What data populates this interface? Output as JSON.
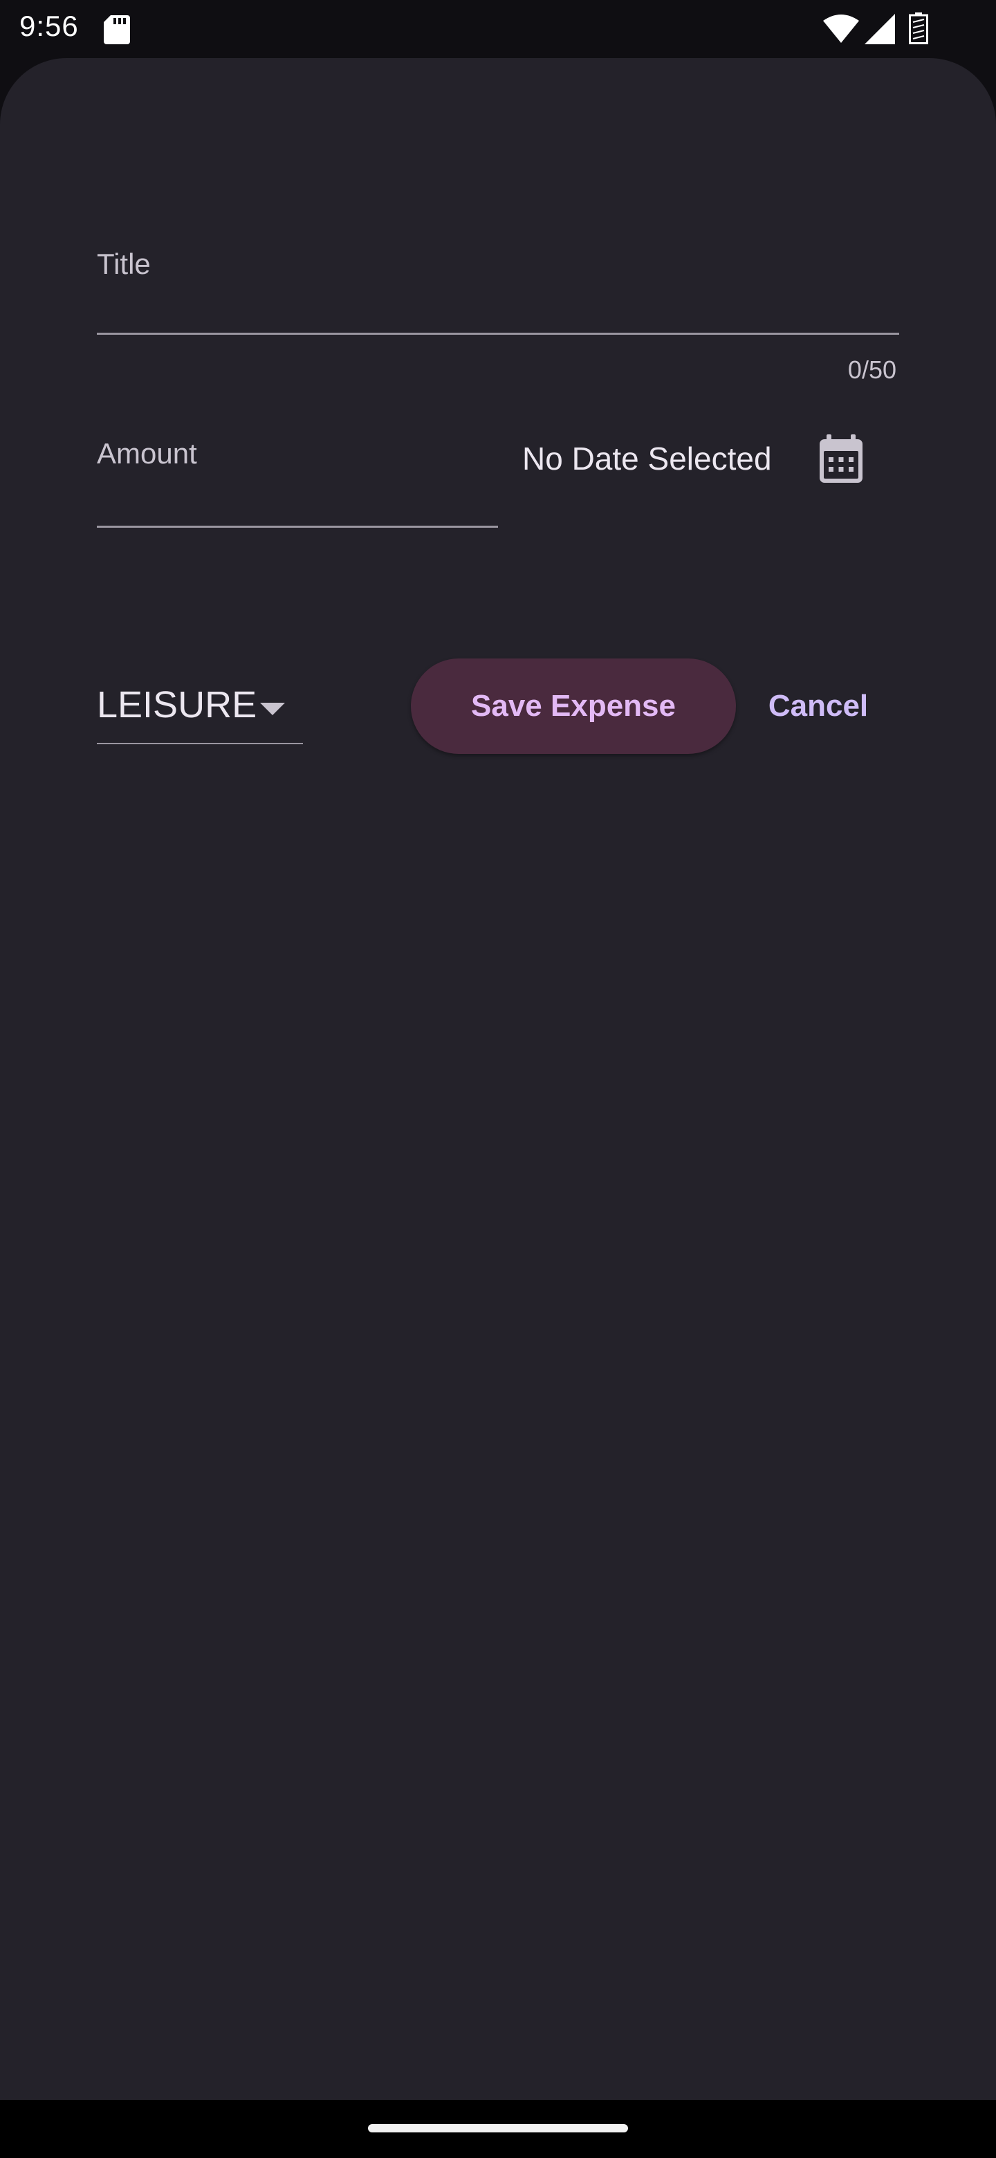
{
  "status_bar": {
    "time": "9:56",
    "icons": [
      "sd-card-icon",
      "wifi-icon",
      "signal-icon",
      "battery-icon"
    ]
  },
  "form": {
    "title_field": {
      "label": "Title",
      "value": "",
      "counter": "0/50"
    },
    "amount_field": {
      "label": "Amount",
      "value": ""
    },
    "date": {
      "text": "No Date Selected",
      "icon": "calendar-icon"
    },
    "category": {
      "selected": "LEISURE",
      "icon": "chevron-down-icon"
    },
    "buttons": {
      "save_label": "Save Expense",
      "cancel_label": "Cancel"
    }
  },
  "colors": {
    "sheet_background": "#24222a",
    "screen_background": "#0f0e12",
    "save_button_bg": "#4a2a3e",
    "save_button_text": "#e3b9f5",
    "cancel_text": "#cfbcf7"
  }
}
